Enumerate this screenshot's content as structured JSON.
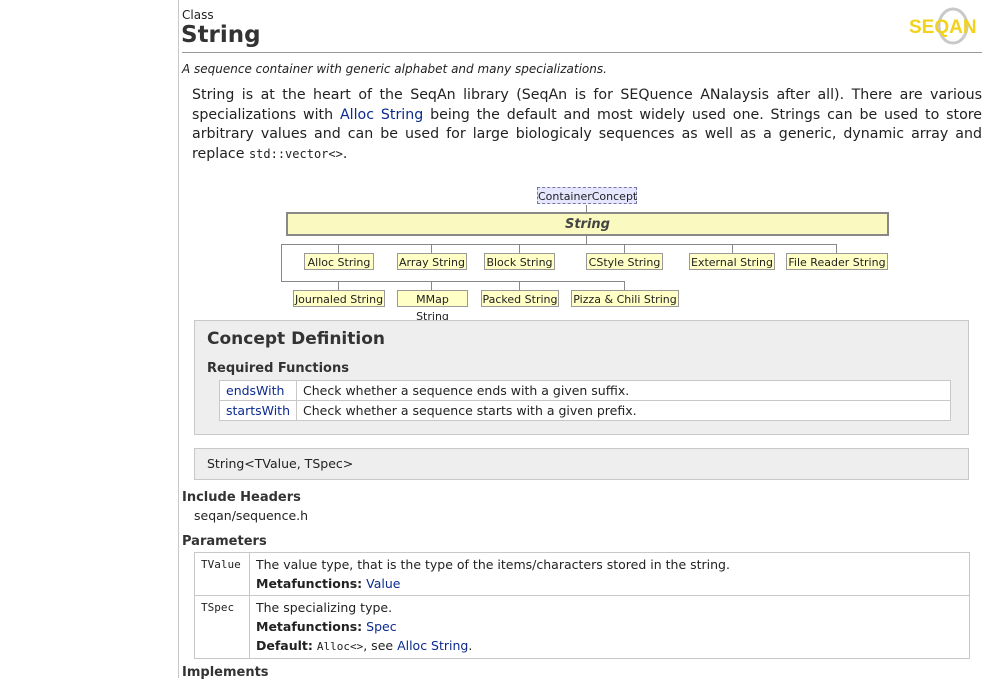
{
  "header": {
    "kind": "Class",
    "title": "String",
    "logo_text": "SEQAN",
    "brief": "A sequence container with generic alphabet and many specializations."
  },
  "description": {
    "part1": "String is at the heart of the SeqAn library (SeqAn is for SEQuence ANalaysis after all). There are various specializations with ",
    "link": "Alloc String",
    "part2": " being the default and most widely used one. Strings can be used to store arbitrary values and can be used for large biologicaly sequences as well as a generic, dynamic array and replace ",
    "code": "std::vector<>",
    "part3": "."
  },
  "diagram": {
    "concept": "ContainerConcept",
    "main": "String",
    "row1": [
      "Alloc String",
      "Array String",
      "Block String",
      "CStyle String",
      "External String",
      "File Reader String"
    ],
    "row2": [
      "Journaled String",
      "MMap String",
      "Packed String",
      "Pizza & Chili String"
    ]
  },
  "concept_definition": {
    "heading": "Concept Definition",
    "required_heading": "Required Functions",
    "functions": [
      {
        "name": "endsWith",
        "desc": "Check whether a sequence ends with a given suffix."
      },
      {
        "name": "startsWith",
        "desc": "Check whether a sequence starts with a given prefix."
      }
    ]
  },
  "signature": "String<TValue, TSpec>",
  "include": {
    "heading": "Include Headers",
    "path": "seqan/sequence.h"
  },
  "parameters": {
    "heading": "Parameters",
    "items": [
      {
        "name": "TValue",
        "desc": "The value type, that is the type of the items/characters stored in the string.",
        "meta_label": "Metafunctions:",
        "meta_link": "Value"
      },
      {
        "name": "TSpec",
        "desc": "The specializing type.",
        "meta_label": "Metafunctions:",
        "meta_link": "Spec",
        "default_label": "Default:",
        "default_code": "Alloc<>",
        "default_sep": ", see ",
        "default_link": "Alloc String",
        "default_end": "."
      }
    ]
  },
  "implements_heading": "Implements",
  "colors": {
    "link": "#0b2a8f",
    "diagram_node": "#ffffc6",
    "concept_node": "#e6e6ff",
    "box_bg": "#eeeeee",
    "logo_yellow": "#f2d21b"
  }
}
